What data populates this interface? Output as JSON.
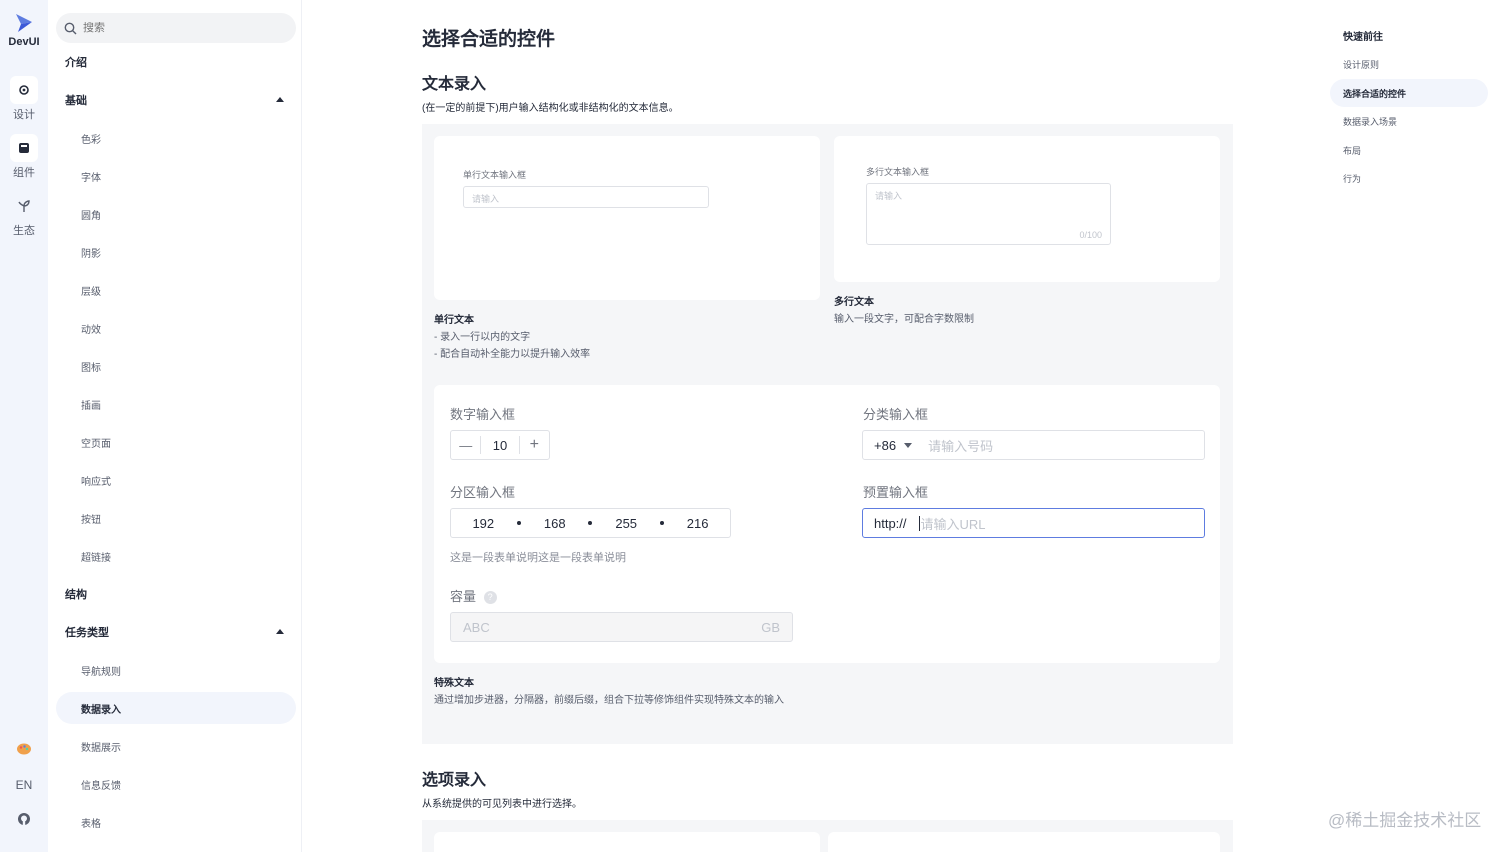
{
  "brand": "DevUI",
  "rail": {
    "items": [
      {
        "label": "设计",
        "icon": "design-icon"
      },
      {
        "label": "组件",
        "icon": "component-icon"
      },
      {
        "label": "生态",
        "icon": "ecosystem-icon"
      }
    ],
    "bottom": {
      "theme_icon": "palette-icon",
      "lang": "EN",
      "github_icon": "github-icon"
    }
  },
  "sidebar": {
    "search_placeholder": "搜索",
    "items": [
      {
        "label": "介绍",
        "type": "group"
      },
      {
        "label": "基础",
        "type": "group",
        "expanded": true
      },
      {
        "label": "色彩",
        "type": "child"
      },
      {
        "label": "字体",
        "type": "child"
      },
      {
        "label": "圆角",
        "type": "child"
      },
      {
        "label": "阴影",
        "type": "child"
      },
      {
        "label": "层级",
        "type": "child"
      },
      {
        "label": "动效",
        "type": "child"
      },
      {
        "label": "图标",
        "type": "child"
      },
      {
        "label": "插画",
        "type": "child"
      },
      {
        "label": "空页面",
        "type": "child"
      },
      {
        "label": "响应式",
        "type": "child"
      },
      {
        "label": "按钮",
        "type": "child"
      },
      {
        "label": "超链接",
        "type": "child"
      },
      {
        "label": "结构",
        "type": "group"
      },
      {
        "label": "任务类型",
        "type": "group",
        "expanded": true
      },
      {
        "label": "导航规则",
        "type": "child"
      },
      {
        "label": "数据录入",
        "type": "child",
        "active": true
      },
      {
        "label": "数据展示",
        "type": "child"
      },
      {
        "label": "信息反馈",
        "type": "child"
      },
      {
        "label": "表格",
        "type": "child"
      }
    ]
  },
  "main": {
    "title": "选择合适的控件",
    "text_entry": {
      "heading": "文本录入",
      "description": "(在一定的前提下)用户输入结构化或非结构化的文本信息。",
      "single": {
        "label": "单行文本输入框",
        "placeholder": "请输入",
        "caption_title": "单行文本",
        "caption_lines": [
          "- 录入一行以内的文字",
          "- 配合自动补全能力以提升输入效率"
        ]
      },
      "multi": {
        "label": "多行文本输入框",
        "placeholder": "请输入",
        "counter": "0/100",
        "caption_title": "多行文本",
        "caption_line": "输入一段文字，可配合字数限制"
      },
      "special": {
        "number_label": "数字输入框",
        "number_value": "10",
        "minus": "—",
        "plus": "+",
        "category_label": "分类输入框",
        "category_prefix": "+86",
        "category_placeholder": "请输入号码",
        "partition_label": "分区输入框",
        "ip": [
          "192",
          "168",
          "255",
          "216"
        ],
        "partition_help": "这是一段表单说明这是一段表单说明",
        "preset_label": "预置输入框",
        "preset_prefix": "http://",
        "preset_placeholder": "请输入URL",
        "capacity_label": "容量",
        "capacity_help_icon": "question-icon",
        "capacity_value": "ABC",
        "capacity_unit": "GB",
        "caption_title": "特殊文本",
        "caption_line": "通过增加步进器，分隔器，前缀后缀，组合下拉等修饰组件实现特殊文本的输入"
      }
    },
    "option_entry": {
      "heading": "选项录入",
      "description": "从系统提供的可见列表中进行选择。"
    }
  },
  "toc": {
    "title": "快速前往",
    "items": [
      {
        "label": "设计原则"
      },
      {
        "label": "选择合适的控件",
        "active": true
      },
      {
        "label": "数据录入场景"
      },
      {
        "label": "布局"
      },
      {
        "label": "行为"
      }
    ]
  },
  "watermark": "@稀土掘金技术社区",
  "colors": {
    "brand": "#5e7ce0",
    "active_bg": "#f2f5fc",
    "demo_bg": "#f5f6f8"
  }
}
